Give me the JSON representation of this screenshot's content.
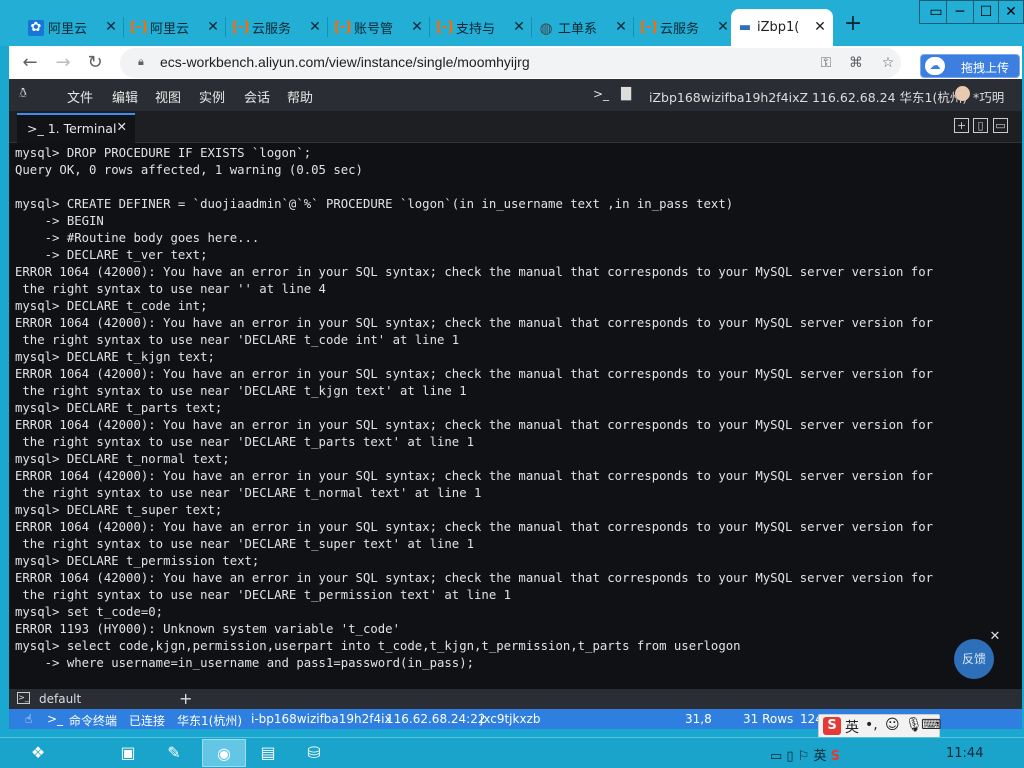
{
  "browser": {
    "tabs": [
      {
        "label": "阿里云",
        "icon": "aliyun-icon"
      },
      {
        "label": "阿里云",
        "icon": "aliyun-bracket-icon"
      },
      {
        "label": "云服务",
        "icon": "aliyun-bracket-icon"
      },
      {
        "label": "账号管",
        "icon": "aliyun-bracket-icon"
      },
      {
        "label": "支持与",
        "icon": "aliyun-bracket-icon"
      },
      {
        "label": "工单系",
        "icon": "globe-icon"
      },
      {
        "label": "云服务",
        "icon": "aliyun-bracket-icon"
      },
      {
        "label": "iZbp1(",
        "icon": "terminal-icon"
      }
    ],
    "new_tab": "+",
    "window_buttons": [
      "▭",
      "─",
      "☐",
      "✕"
    ],
    "url": "ecs-workbench.aliyun.com/view/instance/single/moomhyijrg",
    "upload_label": "拖拽上传"
  },
  "app": {
    "menu": [
      "文件",
      "编辑",
      "视图",
      "实例",
      "会话",
      "帮助"
    ],
    "session_info": "iZbp168wizifba19h2f4ixZ 116.62.68.24 华东1(杭州)",
    "user": "*巧明"
  },
  "terminal_tab": {
    "label": "1. Terminal",
    "close": "✕"
  },
  "terminal_lines": [
    "mysql> DROP PROCEDURE IF EXISTS `logon`;",
    "Query OK, 0 rows affected, 1 warning (0.05 sec)",
    "",
    "mysql> CREATE DEFINER = `duojiaadmin`@`%` PROCEDURE `logon`(in in_username text ,in in_pass text)",
    "    -> BEGIN",
    "    -> #Routine body goes here...",
    "    -> DECLARE t_ver text;",
    "ERROR 1064 (42000): You have an error in your SQL syntax; check the manual that corresponds to your MySQL server version for",
    " the right syntax to use near '' at line 4",
    "mysql> DECLARE t_code int;",
    "ERROR 1064 (42000): You have an error in your SQL syntax; check the manual that corresponds to your MySQL server version for",
    " the right syntax to use near 'DECLARE t_code int' at line 1",
    "mysql> DECLARE t_kjgn text;",
    "ERROR 1064 (42000): You have an error in your SQL syntax; check the manual that corresponds to your MySQL server version for",
    " the right syntax to use near 'DECLARE t_kjgn text' at line 1",
    "mysql> DECLARE t_parts text;",
    "ERROR 1064 (42000): You have an error in your SQL syntax; check the manual that corresponds to your MySQL server version for",
    " the right syntax to use near 'DECLARE t_parts text' at line 1",
    "mysql> DECLARE t_normal text;",
    "ERROR 1064 (42000): You have an error in your SQL syntax; check the manual that corresponds to your MySQL server version for",
    " the right syntax to use near 'DECLARE t_normal text' at line 1",
    "mysql> DECLARE t_super text;",
    "ERROR 1064 (42000): You have an error in your SQL syntax; check the manual that corresponds to your MySQL server version for",
    " the right syntax to use near 'DECLARE t_super text' at line 1",
    "mysql> DECLARE t_permission text;",
    "ERROR 1064 (42000): You have an error in your SQL syntax; check the manual that corresponds to your MySQL server version for",
    " the right syntax to use near 'DECLARE t_permission text' at line 1",
    "mysql> set t_code=0;",
    "ERROR 1193 (HY000): Unknown system variable 't_code'",
    "mysql> select code,kjgn,permission,userpart into t_code,t_kjgn,t_permission,t_parts from userlogon",
    "    -> where username=in_username and pass1=password(in_pass);"
  ],
  "feedback_label": "反馈",
  "panel": {
    "tab": "default",
    "add": "+"
  },
  "status": {
    "terminal_label": "命令终端",
    "connection": "已连接",
    "region": "华东1(杭州)",
    "instance": "i-bp168wizifba19h2f4ix",
    "ip": "116.62.68.24:22",
    "session_id": "jxc9tjkxzb",
    "cursor": "31,8",
    "rows": "31 Rows",
    "cols": "124"
  },
  "ime": {
    "lang": "英",
    "punct": "•,"
  },
  "taskbar": {
    "items": [
      "windows-logo-icon",
      "monitor-icon",
      "tools-icon",
      "chrome-icon",
      "document-icon",
      "network-icon"
    ],
    "tray_lang": "英",
    "clock": "11:44"
  },
  "colors": {
    "accent": "#2f7fe0",
    "terminal_bg": "#101114",
    "desktop": "#1aa8d0"
  }
}
